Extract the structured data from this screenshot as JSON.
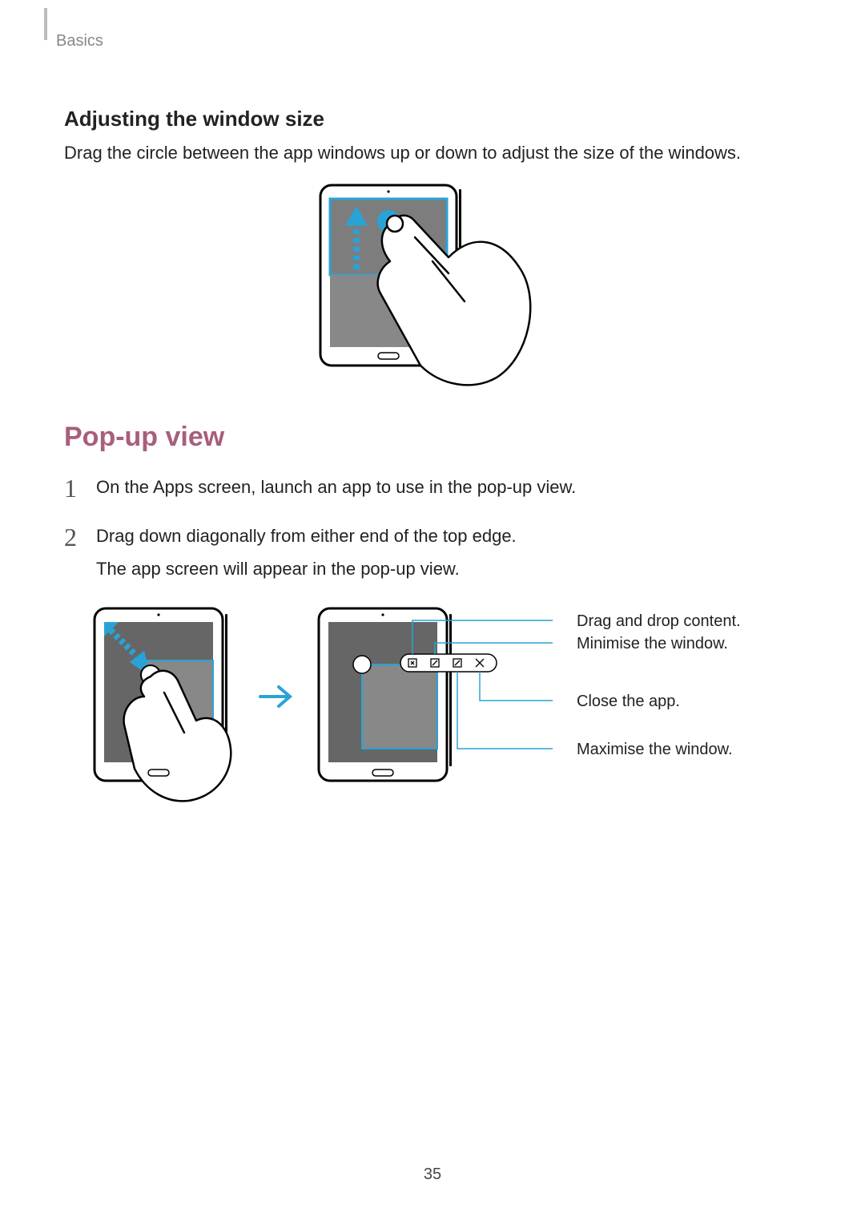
{
  "breadcrumb": "Basics",
  "section_sub": "Adjusting the window size",
  "adjust_text": "Drag the circle between the app windows up or down to adjust the size of the windows.",
  "section": "Pop-up view",
  "steps": [
    "On the Apps screen, launch an app to use in the pop-up view.",
    "Drag down diagonally from either end of the top edge."
  ],
  "step2_extra": "The app screen will appear in the pop-up view.",
  "callouts": {
    "drag": "Drag and drop content.",
    "minimise": "Minimise the window.",
    "close": "Close the app.",
    "maximise": "Maximise the window."
  },
  "page_number": "35"
}
